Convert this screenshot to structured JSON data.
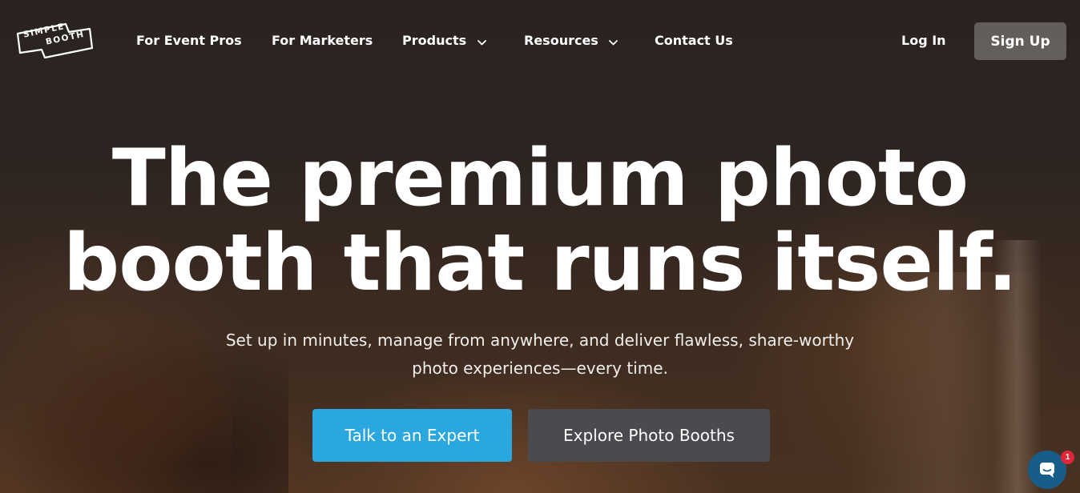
{
  "logo": {
    "line1": "SIMPLE",
    "line2": "BOOTH"
  },
  "nav": {
    "items": [
      {
        "label": "For Event Pros",
        "has_dropdown": false
      },
      {
        "label": "For Marketers",
        "has_dropdown": false
      },
      {
        "label": "Products",
        "has_dropdown": true
      },
      {
        "label": "Resources",
        "has_dropdown": true
      },
      {
        "label": "Contact Us",
        "has_dropdown": false
      }
    ],
    "login_label": "Log In",
    "signup_label": "Sign Up"
  },
  "hero": {
    "headline_line1": "The premium photo",
    "headline_line2": "booth that runs itself.",
    "subtext_line1": "Set up in minutes, manage from anywhere, and deliver flawless, share-worthy",
    "subtext_line2": "photo experiences—every time.",
    "primary_cta": "Talk to an Expert",
    "secondary_cta": "Explore Photo Booths"
  },
  "chat": {
    "icon": "chat-bubble-icon",
    "badge_count": "1"
  },
  "colors": {
    "primary_button": "#2aa7df",
    "secondary_button": "#4a4b4e",
    "signup_button": "#6e6966",
    "chat_button": "#175d8a",
    "badge": "#e0263a"
  }
}
